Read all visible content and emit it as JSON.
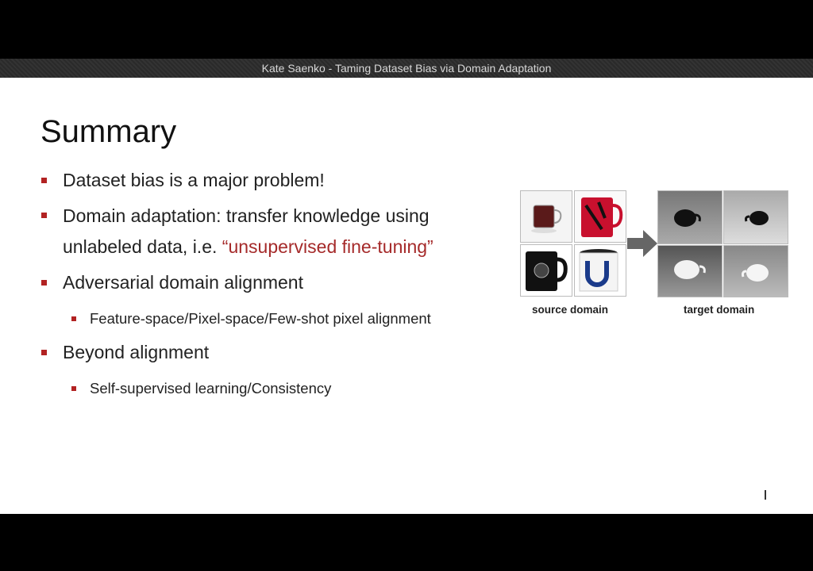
{
  "window": {
    "title": "Kate Saenko - Taming Dataset Bias via Domain Adaptation"
  },
  "slide": {
    "title": "Summary",
    "bullets": [
      {
        "text": "Dataset bias is a major problem!"
      },
      {
        "line1": "Domain adaptation: transfer knowledge using",
        "line2_prefix": "unlabeled data, i.e. ",
        "line2_highlight": "“unsupervised fine-tuning”"
      },
      {
        "text": "Adversarial domain alignment",
        "sub": [
          "Feature-space/Pixel-space/Few-shot pixel alignment"
        ]
      },
      {
        "text": "Beyond alignment",
        "sub": [
          "Self-supervised learning/Consistency"
        ]
      }
    ],
    "figure": {
      "source_label": "source domain",
      "target_label": "target domain"
    },
    "colors": {
      "bullet": "#b22222",
      "highlight": "#a52a2a",
      "arrow": "#666666"
    }
  }
}
